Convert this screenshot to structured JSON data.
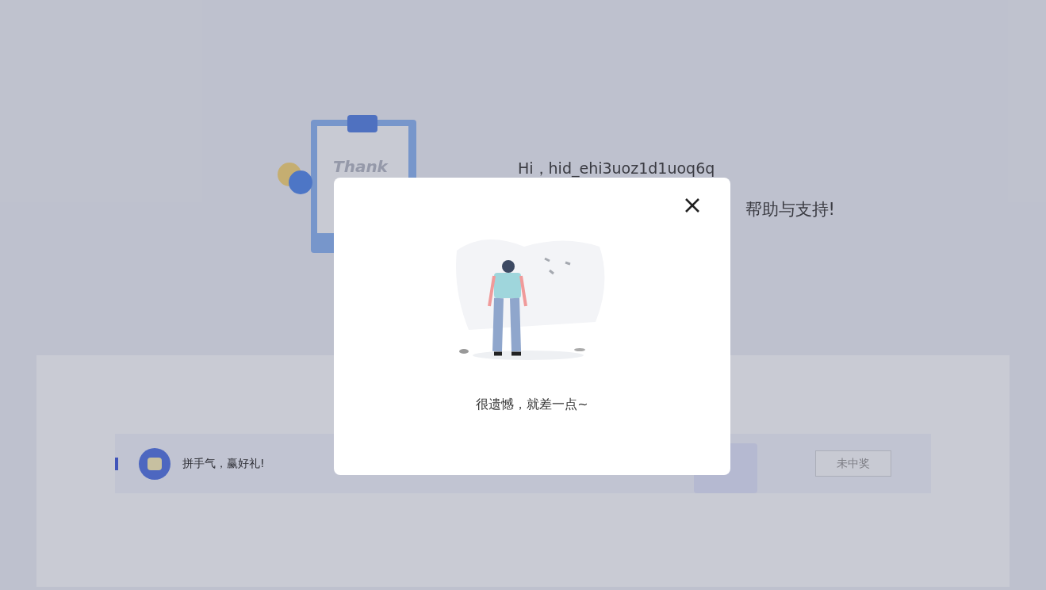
{
  "page": {
    "illustration_text": "Thank",
    "greeting": "Hi，hid_ehi3uoz1d1uoq6q",
    "thanks_line": "帮助与支持!",
    "activity": {
      "title": "拼手气，赢好礼!",
      "status_button": "未中奖"
    }
  },
  "dialog": {
    "message": "很遗憾，就差一点~"
  }
}
